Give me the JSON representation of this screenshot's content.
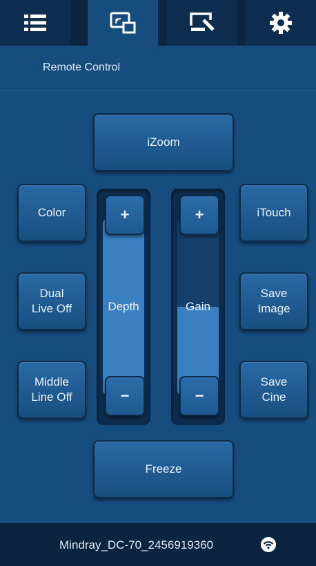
{
  "tabs": [
    {
      "icon": "list-icon",
      "active": false
    },
    {
      "icon": "remote-screen-icon",
      "active": true
    },
    {
      "icon": "monitor-edit-icon",
      "active": false
    },
    {
      "icon": "gear-icon",
      "active": false
    }
  ],
  "section_title": "Remote Control",
  "buttons": {
    "izoom": "iZoom",
    "color": "Color",
    "itouch": "iTouch",
    "dual_live": "Dual\nLive Off",
    "save_image": "Save\nImage",
    "middle_line": "Middle\nLine Off",
    "save_cine": "Save\nCine",
    "freeze": "Freeze"
  },
  "depth": {
    "label": "Depth",
    "plus": "+",
    "minus": "−",
    "level": 1.0
  },
  "gain": {
    "label": "Gain",
    "plus": "+",
    "minus": "−",
    "level": 0.5
  },
  "footer": {
    "device": "Mindray_DC-70_2456919360",
    "icon": "wifi-icon"
  },
  "colors": {
    "background": "#164c7e",
    "bar": "#0b2540",
    "accent": "#3a7fc0"
  }
}
